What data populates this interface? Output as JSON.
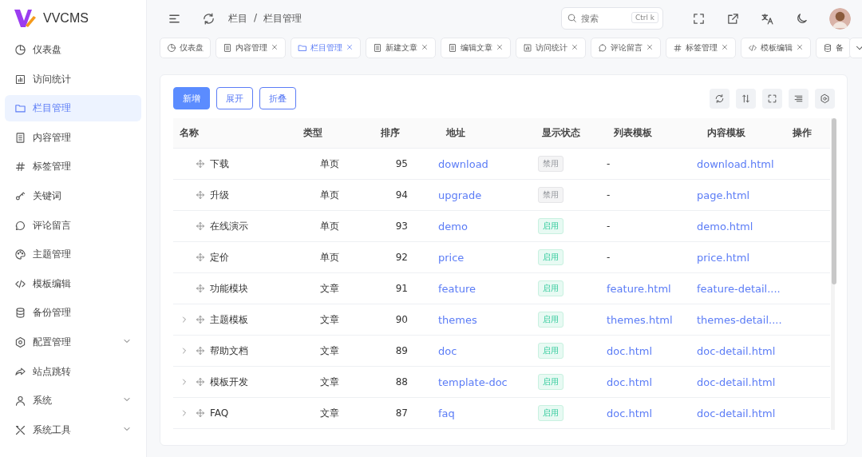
{
  "app": {
    "name": "VVCMS"
  },
  "sidebar": {
    "items": [
      {
        "label": "仪表盘",
        "selected": false,
        "has_submenu": false
      },
      {
        "label": "访问统计",
        "selected": false,
        "has_submenu": false
      },
      {
        "label": "栏目管理",
        "selected": true,
        "has_submenu": false
      },
      {
        "label": "内容管理",
        "selected": false,
        "has_submenu": false
      },
      {
        "label": "标签管理",
        "selected": false,
        "has_submenu": false
      },
      {
        "label": "关键词",
        "selected": false,
        "has_submenu": false
      },
      {
        "label": "评论留言",
        "selected": false,
        "has_submenu": false
      },
      {
        "label": "主题管理",
        "selected": false,
        "has_submenu": false
      },
      {
        "label": "模板编辑",
        "selected": false,
        "has_submenu": false
      },
      {
        "label": "备份管理",
        "selected": false,
        "has_submenu": false
      },
      {
        "label": "配置管理",
        "selected": false,
        "has_submenu": true
      },
      {
        "label": "站点跳转",
        "selected": false,
        "has_submenu": false
      },
      {
        "label": "系统",
        "selected": false,
        "has_submenu": true
      },
      {
        "label": "系统工具",
        "selected": false,
        "has_submenu": true
      }
    ]
  },
  "header": {
    "breadcrumb": [
      "栏目",
      "/",
      "栏目管理"
    ],
    "search": {
      "placeholder": "搜索",
      "shortcut": "Ctrl k"
    }
  },
  "tabs": [
    {
      "label": "仪表盘",
      "selected": false,
      "closable": false
    },
    {
      "label": "内容管理",
      "selected": false,
      "closable": true
    },
    {
      "label": "栏目管理",
      "selected": true,
      "closable": true
    },
    {
      "label": "新建文章",
      "selected": false,
      "closable": true
    },
    {
      "label": "编辑文章",
      "selected": false,
      "closable": true
    },
    {
      "label": "访问统计",
      "selected": false,
      "closable": true
    },
    {
      "label": "评论留言",
      "selected": false,
      "closable": true
    },
    {
      "label": "标签管理",
      "selected": false,
      "closable": true
    },
    {
      "label": "模板编辑",
      "selected": false,
      "closable": true
    },
    {
      "label": "备",
      "selected": false,
      "closable": false
    }
  ],
  "toolbar": {
    "buttons": [
      {
        "label": "新增",
        "kind": "primary"
      },
      {
        "label": "展开",
        "kind": "outline"
      },
      {
        "label": "折叠",
        "kind": "outline"
      }
    ]
  },
  "table": {
    "columns": [
      "名称",
      "类型",
      "排序",
      "地址",
      "显示状态",
      "列表模板",
      "内容模板",
      "操作"
    ],
    "rows": [
      {
        "name": "下载",
        "expandable": false,
        "type": "单页",
        "order": "95",
        "address": "download",
        "enabled": false,
        "status": "禁用",
        "list_template": "-",
        "content_template": "download.html"
      },
      {
        "name": "升级",
        "expandable": false,
        "type": "单页",
        "order": "94",
        "address": "upgrade",
        "enabled": false,
        "status": "禁用",
        "list_template": "-",
        "content_template": "page.html"
      },
      {
        "name": "在线演示",
        "expandable": false,
        "type": "单页",
        "order": "93",
        "address": "demo",
        "enabled": true,
        "status": "启用",
        "list_template": "-",
        "content_template": "demo.html"
      },
      {
        "name": "定价",
        "expandable": false,
        "type": "单页",
        "order": "92",
        "address": "price",
        "enabled": true,
        "status": "启用",
        "list_template": "-",
        "content_template": "price.html"
      },
      {
        "name": "功能模块",
        "expandable": false,
        "type": "文章",
        "order": "91",
        "address": "feature",
        "enabled": true,
        "status": "启用",
        "list_template": "feature.html",
        "content_template": "feature-detail...."
      },
      {
        "name": "主题模板",
        "expandable": true,
        "type": "文章",
        "order": "90",
        "address": "themes",
        "enabled": true,
        "status": "启用",
        "list_template": "themes.html",
        "content_template": "themes-detail...."
      },
      {
        "name": "帮助文档",
        "expandable": true,
        "type": "文章",
        "order": "89",
        "address": "doc",
        "enabled": true,
        "status": "启用",
        "list_template": "doc.html",
        "content_template": "doc-detail.html"
      },
      {
        "name": "模板开发",
        "expandable": true,
        "type": "文章",
        "order": "88",
        "address": "template-doc",
        "enabled": true,
        "status": "启用",
        "list_template": "doc.html",
        "content_template": "doc-detail.html"
      },
      {
        "name": "FAQ",
        "expandable": true,
        "type": "文章",
        "order": "87",
        "address": "faq",
        "enabled": true,
        "status": "启用",
        "list_template": "doc.html",
        "content_template": "doc-detail.html"
      }
    ]
  }
}
